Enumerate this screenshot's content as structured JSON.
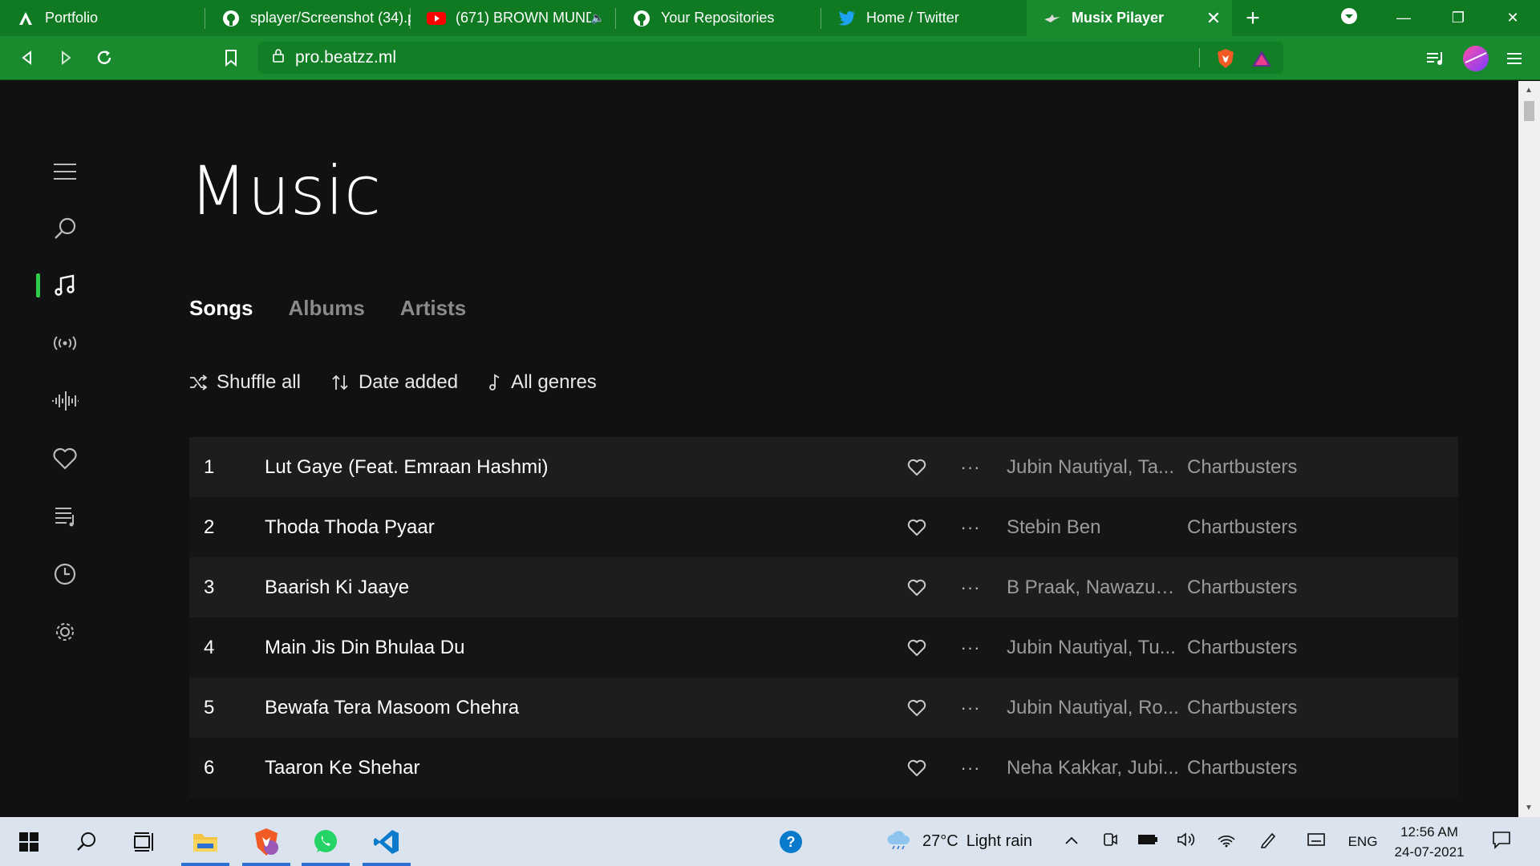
{
  "browser": {
    "tabs": [
      {
        "title": "Portfolio",
        "icon": "letter-a-icon",
        "active": false
      },
      {
        "title": "splayer/Screenshot (34).p",
        "icon": "github-icon",
        "active": false
      },
      {
        "title": "(671) BROWN MUND",
        "icon": "youtube-icon",
        "active": false,
        "audio": true
      },
      {
        "title": "Your Repositories",
        "icon": "github-icon",
        "active": false
      },
      {
        "title": "Home / Twitter",
        "icon": "twitter-icon",
        "active": false
      },
      {
        "title": "Musix Pilayer",
        "icon": "bird-icon",
        "active": true
      }
    ],
    "url": "pro.beatzz.ml",
    "colors": {
      "chrome": "#0f7a22",
      "toolbar": "#1a8a2e"
    }
  },
  "sidebar": {
    "items": [
      {
        "icon": "menu-icon"
      },
      {
        "icon": "search-icon"
      },
      {
        "icon": "music-note-icon",
        "active": true
      },
      {
        "icon": "radio-icon"
      },
      {
        "icon": "waveform-icon"
      },
      {
        "icon": "heart-icon"
      },
      {
        "icon": "playlist-icon"
      },
      {
        "icon": "history-icon"
      },
      {
        "icon": "settings-icon"
      }
    ],
    "accent": "#2ecc4a"
  },
  "main": {
    "title": "Music",
    "tabs": [
      {
        "label": "Songs",
        "active": true
      },
      {
        "label": "Albums",
        "active": false
      },
      {
        "label": "Artists",
        "active": false
      }
    ],
    "filters": {
      "shuffle": "Shuffle all",
      "sort": "Date added",
      "genre": "All genres"
    },
    "songs": [
      {
        "num": "1",
        "title": "Lut Gaye (Feat. Emraan Hashmi)",
        "more": "···",
        "artist": "Jubin Nautiyal, Ta...",
        "genre": "Chartbusters"
      },
      {
        "num": "2",
        "title": "Thoda Thoda Pyaar",
        "more": "···",
        "artist": "Stebin Ben",
        "genre": "Chartbusters"
      },
      {
        "num": "3",
        "title": "Baarish Ki Jaaye",
        "more": "···",
        "artist": "B Praak, Nawazud...",
        "genre": "Chartbusters"
      },
      {
        "num": "4",
        "title": "Main Jis Din Bhulaa Du",
        "more": "···",
        "artist": "Jubin Nautiyal, Tu...",
        "genre": "Chartbusters"
      },
      {
        "num": "5",
        "title": "Bewafa Tera Masoom Chehra",
        "more": "···",
        "artist": "Jubin Nautiyal, Ro...",
        "genre": "Chartbusters"
      },
      {
        "num": "6",
        "title": "Taaron Ke Shehar",
        "more": "···",
        "artist": "Neha Kakkar, Jubi...",
        "genre": "Chartbusters"
      }
    ]
  },
  "taskbar": {
    "weather": {
      "temp": "27°C",
      "condition": "Light rain"
    },
    "language": "ENG",
    "time": "12:56 AM",
    "date": "24-07-2021"
  }
}
